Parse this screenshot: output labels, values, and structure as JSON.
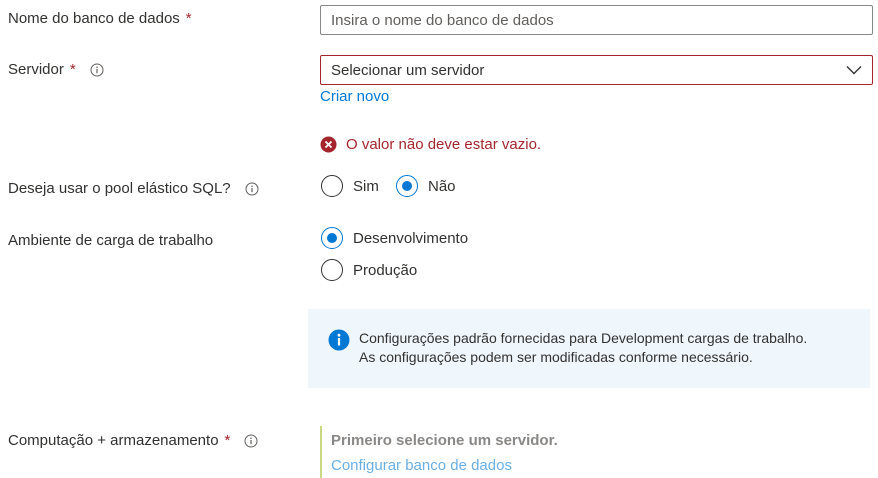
{
  "database_name": {
    "label": "Nome do banco de dados",
    "required_mark": "*",
    "placeholder": "Insira o nome do banco de dados"
  },
  "server": {
    "label": "Servidor",
    "required_mark": "*",
    "select_value": "Selecionar um servidor",
    "create_link": "Criar novo",
    "error": "O valor não deve estar vazio."
  },
  "elastic_pool": {
    "label": "Deseja usar o pool elástico SQL?",
    "options": [
      "Sim",
      "Não"
    ],
    "selected": "Não"
  },
  "workload": {
    "label": "Ambiente de carga de trabalho",
    "options": [
      "Desenvolvimento",
      "Produção"
    ],
    "selected": "Desenvolvimento"
  },
  "info_banner": {
    "line1": "Configurações padrão fornecidas para Development cargas de trabalho.",
    "line2": "As configurações podem ser modificadas conforme necessário."
  },
  "compute": {
    "label": "Computação + armazenamento",
    "required_mark": "*",
    "message": "Primeiro selecione um servidor.",
    "link": "Configurar banco de dados"
  },
  "colors": {
    "accent": "#0078d4",
    "error": "#a4262c",
    "info_bg": "#eff6fc"
  }
}
